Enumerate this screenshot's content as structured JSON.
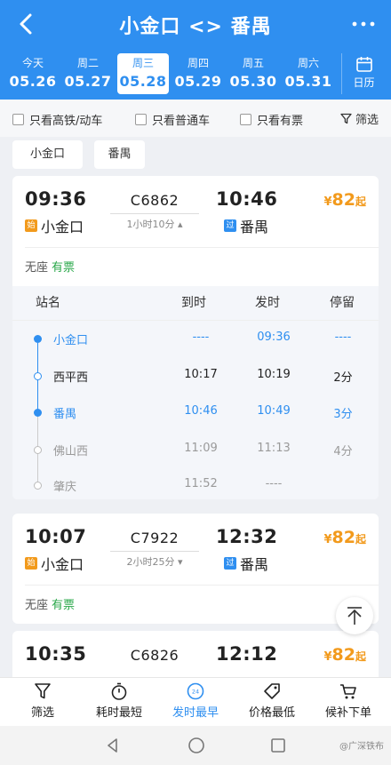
{
  "header": {
    "title": "小金口 <> 番禺"
  },
  "dates": [
    {
      "weekday": "今天",
      "date": "05.26"
    },
    {
      "weekday": "周二",
      "date": "05.27"
    },
    {
      "weekday": "周三",
      "date": "05.28"
    },
    {
      "weekday": "周四",
      "date": "05.29"
    },
    {
      "weekday": "周五",
      "date": "05.30"
    },
    {
      "weekday": "周六",
      "date": "05.31"
    }
  ],
  "calendar_label": "日历",
  "filters": {
    "gaotie": "只看高铁/动车",
    "putong": "只看普通车",
    "youpiao": "只看有票",
    "screen": "筛选"
  },
  "station_tags": [
    "小金口",
    "番禺"
  ],
  "trains": [
    {
      "dep_time": "09:36",
      "arr_time": "10:46",
      "code": "C6862",
      "duration": "1小时10分",
      "price_cur": "¥",
      "price_num": "82",
      "price_suffix": "起",
      "dep_station": "小金口",
      "arr_station": "番禺",
      "dep_badge": "始",
      "arr_badge": "过",
      "seat_type": "无座",
      "seat_status": "有票"
    },
    {
      "dep_time": "10:07",
      "arr_time": "12:32",
      "code": "C7922",
      "duration": "2小时25分",
      "price_cur": "¥",
      "price_num": "82",
      "price_suffix": "起",
      "dep_station": "小金口",
      "arr_station": "番禺",
      "dep_badge": "始",
      "arr_badge": "过",
      "seat_type": "无座",
      "seat_status": "有票"
    },
    {
      "dep_time": "10:35",
      "arr_time": "12:12",
      "code": "C6826",
      "price_cur": "¥",
      "price_num": "82",
      "price_suffix": "起"
    }
  ],
  "stop_header": {
    "name": "站名",
    "arrive": "到时",
    "depart": "发时",
    "stay": "停留"
  },
  "stops": [
    {
      "name": "小金口",
      "arrive": "----",
      "depart": "09:36",
      "stay": "----"
    },
    {
      "name": "西平西",
      "arrive": "10:17",
      "depart": "10:19",
      "stay": "2分"
    },
    {
      "name": "番禺",
      "arrive": "10:46",
      "depart": "10:49",
      "stay": "3分"
    },
    {
      "name": "佛山西",
      "arrive": "11:09",
      "depart": "11:13",
      "stay": "4分"
    },
    {
      "name": "肇庆",
      "arrive": "11:52",
      "depart": "----",
      "stay": ""
    }
  ],
  "bottom_tabs": [
    "筛选",
    "耗时最短",
    "发时最早",
    "价格最低",
    "候补下单"
  ],
  "bottom_badge": "24",
  "watermark": "@广深铁布",
  "colors": {
    "primary": "#2f8ff0",
    "price": "#f29a1c",
    "available": "#2aa84a"
  }
}
